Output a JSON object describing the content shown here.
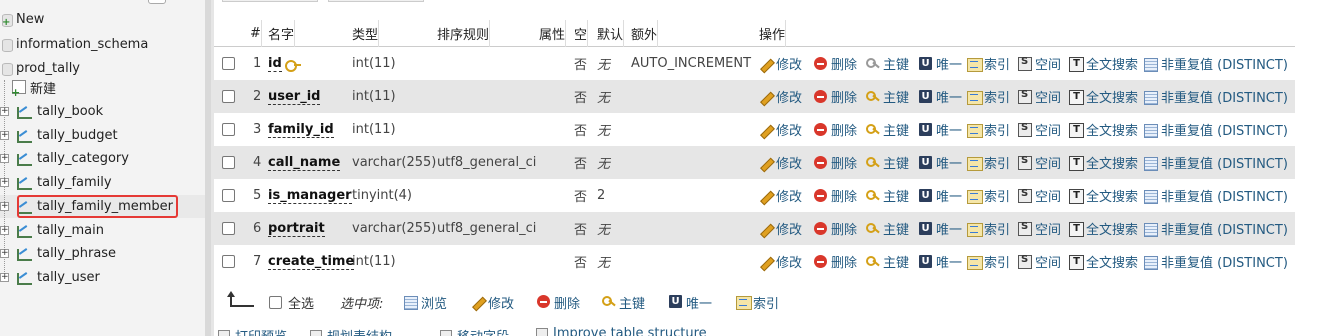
{
  "nav": {
    "databases": [
      {
        "label": "New"
      },
      {
        "label": "information_schema"
      },
      {
        "label": "prod_tally"
      }
    ],
    "new_table_label": "新建",
    "tables": [
      {
        "label": "tally_book"
      },
      {
        "label": "tally_budget"
      },
      {
        "label": "tally_category"
      },
      {
        "label": "tally_family"
      },
      {
        "label": "tally_family_member"
      },
      {
        "label": "tally_main"
      },
      {
        "label": "tally_phrase"
      },
      {
        "label": "tally_user"
      }
    ],
    "expander_symbol": "+",
    "highlight_color": "#e53935"
  },
  "table": {
    "headers": {
      "num": "#",
      "name": "名字",
      "type": "类型",
      "collation": "排序规则",
      "attributes": "属性",
      "null": "空",
      "default": "默认",
      "extra": "额外",
      "action": "操作"
    },
    "rows": [
      {
        "num": "1",
        "name": "id",
        "type": "int(11)",
        "collation": "",
        "attributes": "",
        "null": "否",
        "default": "无",
        "extra": "AUTO_INCREMENT",
        "primary": true
      },
      {
        "num": "2",
        "name": "user_id",
        "type": "int(11)",
        "collation": "",
        "attributes": "",
        "null": "否",
        "default": "无",
        "extra": "",
        "primary": false
      },
      {
        "num": "3",
        "name": "family_id",
        "type": "int(11)",
        "collation": "",
        "attributes": "",
        "null": "否",
        "default": "无",
        "extra": "",
        "primary": false
      },
      {
        "num": "4",
        "name": "call_name",
        "type": "varchar(255)",
        "collation": "utf8_general_ci",
        "attributes": "",
        "null": "否",
        "default": "无",
        "extra": "",
        "primary": false
      },
      {
        "num": "5",
        "name": "is_manager",
        "type": "tinyint(4)",
        "collation": "",
        "attributes": "",
        "null": "否",
        "default": "2",
        "extra": "",
        "primary": false
      },
      {
        "num": "6",
        "name": "portrait",
        "type": "varchar(255)",
        "collation": "utf8_general_ci",
        "attributes": "",
        "null": "否",
        "default": "无",
        "extra": "",
        "primary": false
      },
      {
        "num": "7",
        "name": "create_time",
        "type": "int(11)",
        "collation": "",
        "attributes": "",
        "null": "否",
        "default": "无",
        "extra": "",
        "primary": false
      }
    ],
    "actions": {
      "change": "修改",
      "drop": "删除",
      "primary": "主键",
      "unique": "唯一",
      "index": "索引",
      "spatial": "空间",
      "fulltext": "全文搜索",
      "distinct": "非重复值 (DISTINCT)"
    },
    "row_colors": {
      "odd": "#ffffff",
      "even": "#e6e6e6"
    },
    "link_color": "#235a81"
  },
  "bulk": {
    "check_all": "全选",
    "with_selected": "选中项:",
    "browse": "浏览",
    "change": "修改",
    "drop": "删除",
    "primary": "主键",
    "unique": "唯一",
    "index": "索引"
  },
  "footer": {
    "print": "打印预览",
    "propose": "规划表结构",
    "move": "移动字段",
    "improve": "Improve table structure"
  }
}
